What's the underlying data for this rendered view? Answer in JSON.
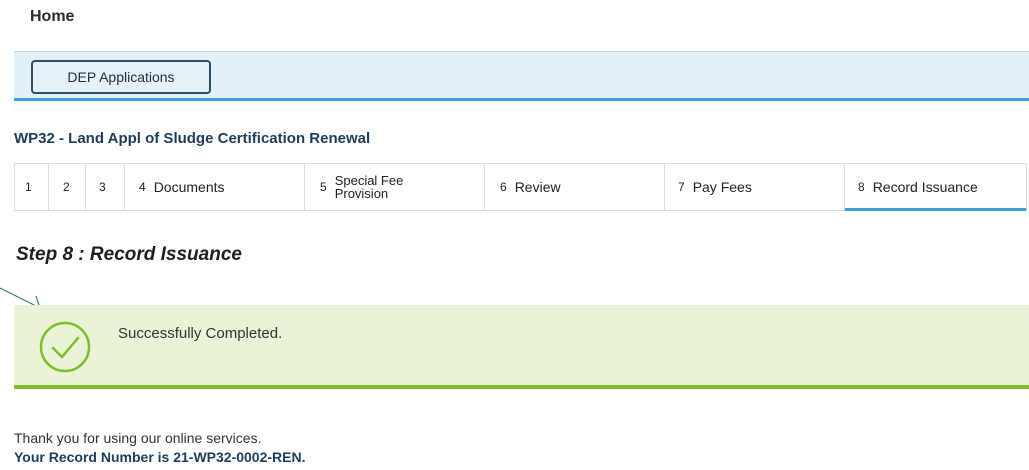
{
  "nav": {
    "home_label": "Home"
  },
  "app_bar": {
    "button_label": "DEP Applications"
  },
  "record": {
    "title": "WP32 - Land Appl of Sludge Certification Renewal"
  },
  "steps": [
    {
      "num": "1",
      "label": ""
    },
    {
      "num": "2",
      "label": ""
    },
    {
      "num": "3",
      "label": ""
    },
    {
      "num": "4",
      "label": "Documents"
    },
    {
      "num": "5",
      "label_line1": "Special Fee",
      "label_line2": "Provision"
    },
    {
      "num": "6",
      "label": "Review"
    },
    {
      "num": "7",
      "label": "Pay Fees"
    },
    {
      "num": "8",
      "label": "Record Issuance"
    }
  ],
  "active_step": "8",
  "step_heading": "Step 8 : Record Issuance",
  "success": {
    "message": "Successfully Completed.",
    "icon": "check-circle-icon"
  },
  "footer": {
    "thanks": "Thank you for using our online services.",
    "record_number_text": "Your Record Number is 21-WP32-0002-REN."
  },
  "colors": {
    "accent_blue": "#3d9fd6",
    "success_green": "#7fbd2a",
    "success_bg": "#e9f3d5",
    "app_bar_bg": "#e3f0f9",
    "title_navy": "#1d3d5c"
  }
}
